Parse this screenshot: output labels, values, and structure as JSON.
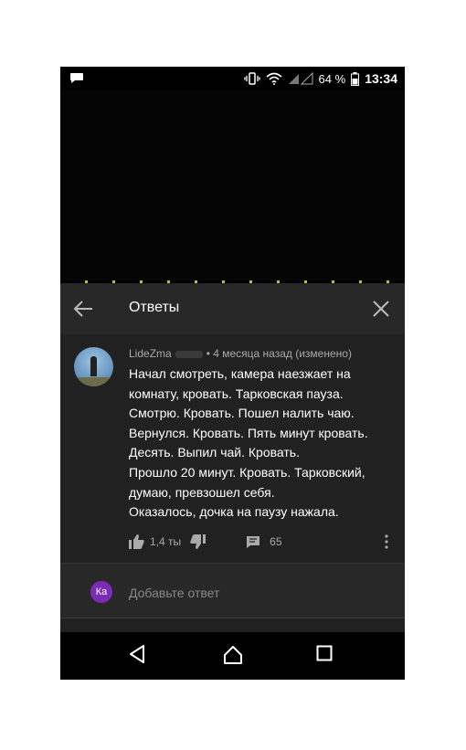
{
  "status_bar": {
    "battery": "64 %",
    "time": "13:34"
  },
  "replies_panel": {
    "title": "Ответы"
  },
  "comment": {
    "author": "LideZma",
    "date": "• 4 месяца назад (изменено)",
    "lines": [
      "Начал смотреть, камера наезжает на",
      "комнату, кровать. Тарковская пауза.",
      "Смотрю. Кровать. Пошел налить чаю.",
      "Вернулся. Кровать. Пять минут кровать.",
      "Десять. Выпил чай. Кровать.",
      "Прошло 20 минут. Кровать. Тарковский,",
      "думаю, превзошел себя.",
      "Оказалось, дочка на паузу нажала."
    ],
    "likes": "1,4 ты",
    "reply_count": "65"
  },
  "reply_box": {
    "avatar_initials": "Ка",
    "placeholder": "Добавьте ответ",
    "avatar_color": "#7b2bb5"
  },
  "icons": [
    "message-icon",
    "vibrate-icon",
    "wifi-icon",
    "signal-icon",
    "battery-icon",
    "back-arrow-icon",
    "close-icon",
    "thumb-up-icon",
    "thumb-down-icon",
    "reply-icon",
    "more-vertical-icon",
    "nav-back-icon",
    "nav-home-icon",
    "nav-recents-icon"
  ]
}
